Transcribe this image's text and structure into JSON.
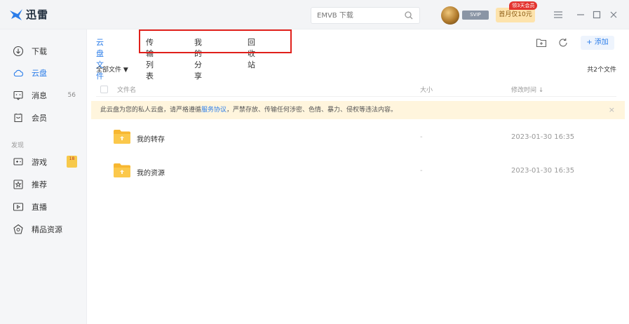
{
  "app": {
    "name": "迅雷",
    "brand_color": "#2b7de9"
  },
  "header": {
    "search_placeholder": "EMVB 下载",
    "svip_badge": "SVIP",
    "vip_promo": "首月仅10元",
    "promo_tag": "领3天会员"
  },
  "sidebar": {
    "items": [
      {
        "label": "下载",
        "icon": "download-icon"
      },
      {
        "label": "云盘",
        "icon": "cloud-icon",
        "active": true
      },
      {
        "label": "消息",
        "icon": "message-icon",
        "count": "56"
      },
      {
        "label": "会员",
        "icon": "member-icon"
      }
    ],
    "section_label": "发现",
    "discover_items": [
      {
        "label": "游戏",
        "icon": "game-icon",
        "badge": "18"
      },
      {
        "label": "推荐",
        "icon": "recommend-icon"
      },
      {
        "label": "直播",
        "icon": "live-icon"
      },
      {
        "label": "精品资源",
        "icon": "resource-icon"
      }
    ]
  },
  "main": {
    "tabs": [
      {
        "label": "云盘文件",
        "active": true
      },
      {
        "label": "传输列表"
      },
      {
        "label": "我的分享"
      },
      {
        "label": "回收站"
      }
    ],
    "add_label": "+ 添加",
    "filter_label": "全部文件 ▼",
    "total_label": "共2个文件",
    "columns": {
      "name": "文件名",
      "size": "大小",
      "modified": "修改时间 ↓"
    },
    "notice": {
      "prefix": "此云盘为您的私人云盘，请严格遵循",
      "link": "服务协议",
      "suffix": "，严禁存放、传输任何涉密、色情、暴力、侵权等违法内容。",
      "close": "×"
    },
    "files": [
      {
        "name": "我的转存",
        "size": "-",
        "modified": "2023-01-30 16:35"
      },
      {
        "name": "我的资源",
        "size": "-",
        "modified": "2023-01-30 16:35"
      }
    ]
  }
}
